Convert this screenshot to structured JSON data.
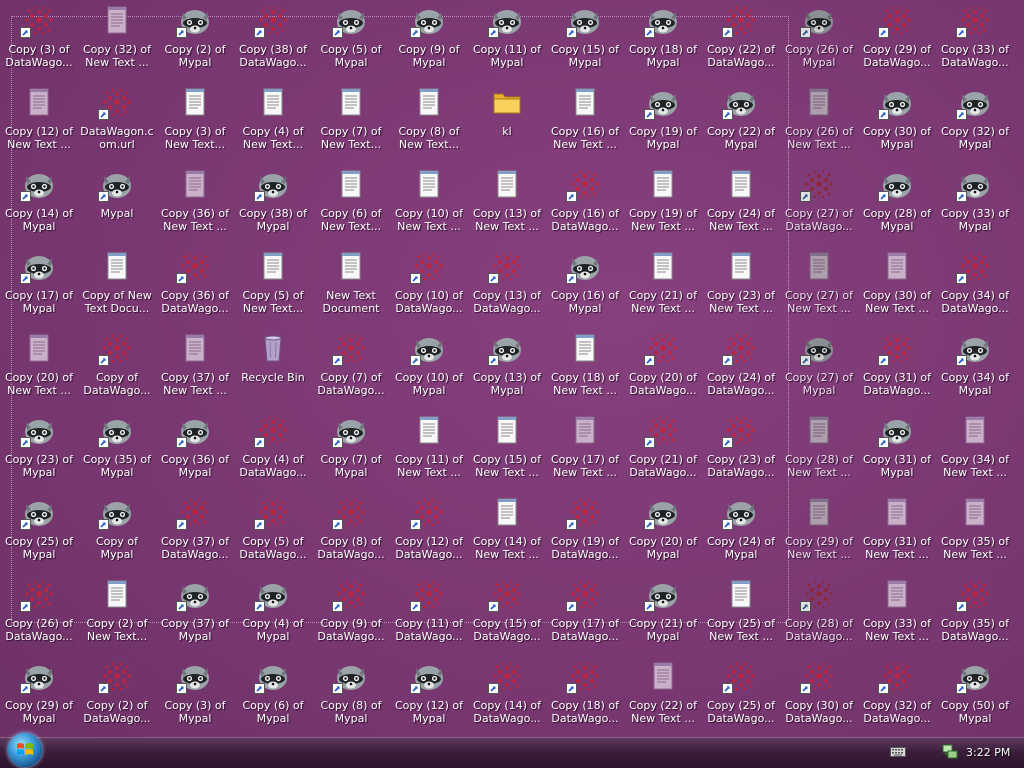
{
  "taskbar": {
    "clock": "3:22 PM"
  },
  "icons": [
    {
      "label": "Copy (3) of\nDataWago...",
      "type": "datawagon",
      "shortcut": true
    },
    {
      "label": "Copy (32) of\nNew Text ...",
      "type": "textdoc_faded",
      "shortcut": false
    },
    {
      "label": "Copy (2) of\nMypal",
      "type": "mypal",
      "shortcut": true
    },
    {
      "label": "Copy (38) of\nDataWago...",
      "type": "datawagon",
      "shortcut": true
    },
    {
      "label": "Copy (5) of\nMypal",
      "type": "mypal",
      "shortcut": true
    },
    {
      "label": "Copy (9) of\nMypal",
      "type": "mypal",
      "shortcut": true
    },
    {
      "label": "Copy (11) of\nMypal",
      "type": "mypal",
      "shortcut": true
    },
    {
      "label": "Copy (15) of\nMypal",
      "type": "mypal",
      "shortcut": true
    },
    {
      "label": "Copy (18) of\nMypal",
      "type": "mypal",
      "shortcut": true
    },
    {
      "label": "Copy (22) of\nDataWago...",
      "type": "datawagon",
      "shortcut": true
    },
    {
      "label": "Copy (26) of\nMypal",
      "type": "mypal",
      "shortcut": true,
      "sel": true
    },
    {
      "label": "Copy (29) of\nDataWago...",
      "type": "datawagon",
      "shortcut": true
    },
    {
      "label": "Copy (33) of\nDataWago...",
      "type": "datawagon",
      "shortcut": true
    },
    {
      "label": "Copy (12) of\nNew Text ...",
      "type": "textdoc_faded",
      "shortcut": false
    },
    {
      "label": "DataWagon.c\nom.url",
      "type": "datawagon",
      "shortcut": true
    },
    {
      "label": "Copy (3) of\nNew Text...",
      "type": "textdoc",
      "shortcut": false
    },
    {
      "label": "Copy (4) of\nNew Text...",
      "type": "textdoc",
      "shortcut": false
    },
    {
      "label": "Copy (7) of\nNew Text...",
      "type": "textdoc",
      "shortcut": false
    },
    {
      "label": "Copy (8) of\nNew Text...",
      "type": "textdoc",
      "shortcut": false
    },
    {
      "label": "kl",
      "type": "folder",
      "shortcut": false
    },
    {
      "label": "Copy (16) of\nNew Text ...",
      "type": "textdoc",
      "shortcut": false
    },
    {
      "label": "Copy (19) of\nMypal",
      "type": "mypal",
      "shortcut": true
    },
    {
      "label": "Copy (22) of\nMypal",
      "type": "mypal",
      "shortcut": true
    },
    {
      "label": "Copy (26) of\nNew Text ...",
      "type": "textdoc_faded",
      "shortcut": false,
      "sel": true
    },
    {
      "label": "Copy (30) of\nMypal",
      "type": "mypal",
      "shortcut": true
    },
    {
      "label": "Copy (32) of\nMypal",
      "type": "mypal",
      "shortcut": true
    },
    {
      "label": "Copy (14) of\nMypal",
      "type": "mypal",
      "shortcut": true
    },
    {
      "label": "Mypal",
      "type": "mypal",
      "shortcut": true
    },
    {
      "label": "Copy (36) of\nNew Text ...",
      "type": "textdoc_faded",
      "shortcut": false
    },
    {
      "label": "Copy (38) of\nMypal",
      "type": "mypal",
      "shortcut": true
    },
    {
      "label": "Copy (6) of\nNew Text...",
      "type": "textdoc",
      "shortcut": false
    },
    {
      "label": "Copy (10) of\nNew Text ...",
      "type": "textdoc",
      "shortcut": false
    },
    {
      "label": "Copy (13) of\nNew Text ...",
      "type": "textdoc",
      "shortcut": false
    },
    {
      "label": "Copy (16) of\nDataWago...",
      "type": "datawagon",
      "shortcut": true
    },
    {
      "label": "Copy (19) of\nNew Text ...",
      "type": "textdoc",
      "shortcut": false
    },
    {
      "label": "Copy (24) of\nNew Text ...",
      "type": "textdoc",
      "shortcut": false
    },
    {
      "label": "Copy (27) of\nDataWago...",
      "type": "datawagon",
      "shortcut": true,
      "sel": true
    },
    {
      "label": "Copy (28) of\nMypal",
      "type": "mypal",
      "shortcut": true
    },
    {
      "label": "Copy (33) of\nMypal",
      "type": "mypal",
      "shortcut": true
    },
    {
      "label": "Copy (17) of\nMypal",
      "type": "mypal",
      "shortcut": true
    },
    {
      "label": "Copy of New\nText Docu...",
      "type": "textdoc",
      "shortcut": false
    },
    {
      "label": "Copy (36) of\nDataWago...",
      "type": "datawagon",
      "shortcut": true
    },
    {
      "label": "Copy (5) of\nNew Text...",
      "type": "textdoc",
      "shortcut": false
    },
    {
      "label": "New Text\nDocument",
      "type": "textdoc",
      "shortcut": false
    },
    {
      "label": "Copy (10) of\nDataWago...",
      "type": "datawagon",
      "shortcut": true
    },
    {
      "label": "Copy (13) of\nDataWago...",
      "type": "datawagon",
      "shortcut": true
    },
    {
      "label": "Copy (16) of\nMypal",
      "type": "mypal",
      "shortcut": true
    },
    {
      "label": "Copy (21) of\nNew Text ...",
      "type": "textdoc",
      "shortcut": false
    },
    {
      "label": "Copy (23) of\nNew Text ...",
      "type": "textdoc",
      "shortcut": false
    },
    {
      "label": "Copy (27) of\nNew Text ...",
      "type": "textdoc_faded",
      "shortcut": false,
      "sel": true
    },
    {
      "label": "Copy (30) of\nNew Text ...",
      "type": "textdoc_faded",
      "shortcut": false
    },
    {
      "label": "Copy (34) of\nDataWago...",
      "type": "datawagon",
      "shortcut": true
    },
    {
      "label": "Copy (20) of\nNew Text ...",
      "type": "textdoc_faded",
      "shortcut": false
    },
    {
      "label": "Copy of\nDataWago...",
      "type": "datawagon",
      "shortcut": true
    },
    {
      "label": "Copy (37) of\nNew Text ...",
      "type": "textdoc_faded",
      "shortcut": false
    },
    {
      "label": "Recycle Bin",
      "type": "recycle",
      "shortcut": false
    },
    {
      "label": "Copy (7) of\nDataWago...",
      "type": "datawagon",
      "shortcut": true
    },
    {
      "label": "Copy (10) of\nMypal",
      "type": "mypal",
      "shortcut": true
    },
    {
      "label": "Copy (13) of\nMypal",
      "type": "mypal",
      "shortcut": true
    },
    {
      "label": "Copy (18) of\nNew Text ...",
      "type": "textdoc",
      "shortcut": false
    },
    {
      "label": "Copy (20) of\nDataWago...",
      "type": "datawagon",
      "shortcut": true
    },
    {
      "label": "Copy (24) of\nDataWago...",
      "type": "datawagon",
      "shortcut": true
    },
    {
      "label": "Copy (27) of\nMypal",
      "type": "mypal",
      "shortcut": true,
      "sel": true
    },
    {
      "label": "Copy (31) of\nDataWago...",
      "type": "datawagon",
      "shortcut": true
    },
    {
      "label": "Copy (34) of\nMypal",
      "type": "mypal",
      "shortcut": true
    },
    {
      "label": "Copy (23) of\nMypal",
      "type": "mypal",
      "shortcut": true
    },
    {
      "label": "Copy (35) of\nMypal",
      "type": "mypal",
      "shortcut": true
    },
    {
      "label": "Copy (36) of\nMypal",
      "type": "mypal",
      "shortcut": true
    },
    {
      "label": "Copy (4) of\nDataWago...",
      "type": "datawagon",
      "shortcut": true
    },
    {
      "label": "Copy (7) of\nMypal",
      "type": "mypal",
      "shortcut": true
    },
    {
      "label": "Copy (11) of\nNew Text ...",
      "type": "textdoc",
      "shortcut": false
    },
    {
      "label": "Copy (15) of\nNew Text ...",
      "type": "textdoc",
      "shortcut": false
    },
    {
      "label": "Copy (17) of\nNew Text ...",
      "type": "textdoc_faded",
      "shortcut": false
    },
    {
      "label": "Copy (21) of\nDataWago...",
      "type": "datawagon",
      "shortcut": true
    },
    {
      "label": "Copy (23) of\nDataWago...",
      "type": "datawagon",
      "shortcut": true
    },
    {
      "label": "Copy (28) of\nNew Text ...",
      "type": "textdoc_faded",
      "shortcut": false,
      "sel": true
    },
    {
      "label": "Copy (31) of\nMypal",
      "type": "mypal",
      "shortcut": true
    },
    {
      "label": "Copy (34) of\nNew Text ...",
      "type": "textdoc_faded",
      "shortcut": false
    },
    {
      "label": "Copy (25) of\nMypal",
      "type": "mypal",
      "shortcut": true
    },
    {
      "label": "Copy of Mypal",
      "type": "mypal",
      "shortcut": true
    },
    {
      "label": "Copy (37) of\nDataWago...",
      "type": "datawagon",
      "shortcut": true
    },
    {
      "label": "Copy (5) of\nDataWago...",
      "type": "datawagon",
      "shortcut": true
    },
    {
      "label": "Copy (8) of\nDataWago...",
      "type": "datawagon",
      "shortcut": true
    },
    {
      "label": "Copy (12) of\nDataWago...",
      "type": "datawagon",
      "shortcut": true
    },
    {
      "label": "Copy (14) of\nNew Text ...",
      "type": "textdoc",
      "shortcut": false
    },
    {
      "label": "Copy (19) of\nDataWago...",
      "type": "datawagon",
      "shortcut": true
    },
    {
      "label": "Copy (20) of\nMypal",
      "type": "mypal",
      "shortcut": true
    },
    {
      "label": "Copy (24) of\nMypal",
      "type": "mypal",
      "shortcut": true
    },
    {
      "label": "Copy (29) of\nNew Text ...",
      "type": "textdoc_faded",
      "shortcut": false,
      "sel": true
    },
    {
      "label": "Copy (31) of\nNew Text ...",
      "type": "textdoc_faded",
      "shortcut": false
    },
    {
      "label": "Copy (35) of\nNew Text ...",
      "type": "textdoc_faded",
      "shortcut": false
    },
    {
      "label": "Copy (26) of\nDataWago...",
      "type": "datawagon",
      "shortcut": true
    },
    {
      "label": "Copy (2) of\nNew Text...",
      "type": "textdoc",
      "shortcut": false
    },
    {
      "label": "Copy (37) of\nMypal",
      "type": "mypal",
      "shortcut": true
    },
    {
      "label": "Copy (4) of\nMypal",
      "type": "mypal",
      "shortcut": true
    },
    {
      "label": "Copy (9) of\nDataWago...",
      "type": "datawagon",
      "shortcut": true
    },
    {
      "label": "Copy (11) of\nDataWago...",
      "type": "datawagon",
      "shortcut": true
    },
    {
      "label": "Copy (15) of\nDataWago...",
      "type": "datawagon",
      "shortcut": true
    },
    {
      "label": "Copy (17) of\nDataWago...",
      "type": "datawagon",
      "shortcut": true
    },
    {
      "label": "Copy (21) of\nMypal",
      "type": "mypal",
      "shortcut": true
    },
    {
      "label": "Copy (25) of\nNew Text ...",
      "type": "textdoc",
      "shortcut": false
    },
    {
      "label": "Copy (28) of\nDataWago...",
      "type": "datawagon",
      "shortcut": true,
      "sel": true
    },
    {
      "label": "Copy (33) of\nNew Text ...",
      "type": "textdoc_faded",
      "shortcut": false
    },
    {
      "label": "Copy (35) of\nDataWago...",
      "type": "datawagon",
      "shortcut": true
    },
    {
      "label": "Copy (29) of\nMypal",
      "type": "mypal",
      "shortcut": true
    },
    {
      "label": "Copy (2) of\nDataWago...",
      "type": "datawagon",
      "shortcut": true
    },
    {
      "label": "Copy (3) of\nMypal",
      "type": "mypal",
      "shortcut": true
    },
    {
      "label": "Copy (6) of\nMypal",
      "type": "mypal",
      "shortcut": true
    },
    {
      "label": "Copy (8) of\nMypal",
      "type": "mypal",
      "shortcut": true
    },
    {
      "label": "Copy (12) of\nMypal",
      "type": "mypal",
      "shortcut": true
    },
    {
      "label": "Copy (14) of\nDataWago...",
      "type": "datawagon",
      "shortcut": true
    },
    {
      "label": "Copy (18) of\nDataWago...",
      "type": "datawagon",
      "shortcut": true
    },
    {
      "label": "Copy (22) of\nNew Text ...",
      "type": "textdoc_faded",
      "shortcut": false
    },
    {
      "label": "Copy (25) of\nDataWago...",
      "type": "datawagon",
      "shortcut": true
    },
    {
      "label": "Copy (30) of\nDataWago...",
      "type": "datawagon",
      "shortcut": true
    },
    {
      "label": "Copy (32) of\nDataWago...",
      "type": "datawagon",
      "shortcut": true
    },
    {
      "label": "Copy (50) of\nMypal",
      "type": "mypal",
      "shortcut": true
    }
  ]
}
